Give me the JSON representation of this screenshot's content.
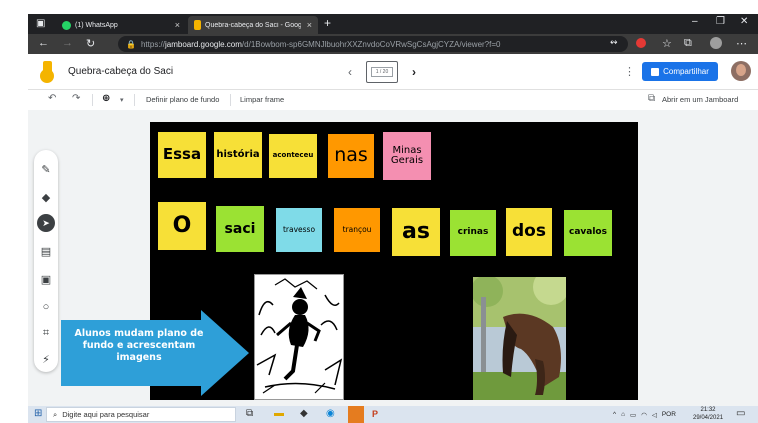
{
  "browser": {
    "tabs": [
      {
        "label": "(1) WhatsApp",
        "active": false
      },
      {
        "label": "Quebra-cabeça do Saci - Googl",
        "active": true
      }
    ],
    "new_tab": "+",
    "url_scheme": "https://",
    "url_host": "jamboard.google.com",
    "url_path": "/d/1Bowbom-sp6GMNJlbuohrXXZnvdoCoVRwSgCsAgjCYZA/viewer?f=0"
  },
  "app": {
    "title": "Quebra-cabeça do Saci",
    "frame_indicator": "1 / 20",
    "share_label": "Compartilhar"
  },
  "toolbar": {
    "set_background": "Definir plano de fundo",
    "clear_frame": "Limpar frame",
    "open_in_jamboard": "Abrir em um Jamboard"
  },
  "board": {
    "row1": [
      {
        "text": "Essa",
        "color": "#f7e037"
      },
      {
        "text": "história",
        "color": "#f7e037"
      },
      {
        "text": "aconteceu",
        "color": "#f7e037"
      },
      {
        "text": "nas",
        "color": "#ff9800"
      },
      {
        "text": "Minas Gerais",
        "color": "#f48fb1"
      }
    ],
    "row2": [
      {
        "text": "O",
        "color": "#f7e037"
      },
      {
        "text": "saci",
        "color": "#9be233"
      },
      {
        "text": "travesso",
        "color": "#7fdbe8"
      },
      {
        "text": "trançou",
        "color": "#ff9800"
      },
      {
        "text": "as",
        "color": "#f7e037"
      },
      {
        "text": "crinas",
        "color": "#9be233"
      },
      {
        "text": "dos",
        "color": "#f7e037"
      },
      {
        "text": "cavalos",
        "color": "#9be233"
      }
    ]
  },
  "callout": {
    "text": "Alunos mudam plano de fundo e acrescentam imagens",
    "color": "#2e9fd8"
  },
  "taskbar": {
    "search_placeholder": "Digite aqui para pesquisar",
    "language": "POR",
    "time": "21:32",
    "date": "29/04/2021"
  }
}
